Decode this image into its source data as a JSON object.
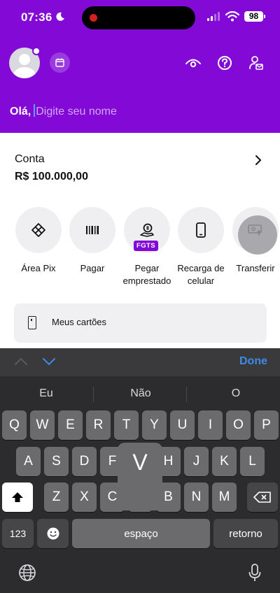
{
  "status_bar": {
    "time": "07:36",
    "battery": "98"
  },
  "greeting": {
    "hello": "Olá,",
    "placeholder": "Digite seu nome"
  },
  "account": {
    "title": "Conta",
    "balance": "R$ 100.000,00"
  },
  "actions": [
    {
      "label": "Área Pix",
      "icon": "pix-icon"
    },
    {
      "label": "Pagar",
      "icon": "barcode-icon"
    },
    {
      "label": "Pegar emprestado",
      "icon": "loan-icon",
      "badge": "FGTS"
    },
    {
      "label": "Recarga de celular",
      "icon": "phone-icon"
    },
    {
      "label": "Transferir",
      "icon": "transfer-icon"
    }
  ],
  "cards": {
    "label": "Meus cartões"
  },
  "keyboard": {
    "done": "Done",
    "suggestions": [
      "Eu",
      "Não",
      "O"
    ],
    "row1": [
      "Q",
      "W",
      "E",
      "R",
      "T",
      "Y",
      "U",
      "I",
      "O",
      "P"
    ],
    "row2": [
      "A",
      "S",
      "D",
      "F",
      "G",
      "H",
      "J",
      "K",
      "L"
    ],
    "row3": [
      "Z",
      "X",
      "C",
      "V",
      "B",
      "N",
      "M"
    ],
    "popup": "V",
    "numbers": "123",
    "space": "espaço",
    "return": "retorno"
  },
  "colors": {
    "brand": "#8209d6",
    "accent": "#3d8ae8"
  }
}
